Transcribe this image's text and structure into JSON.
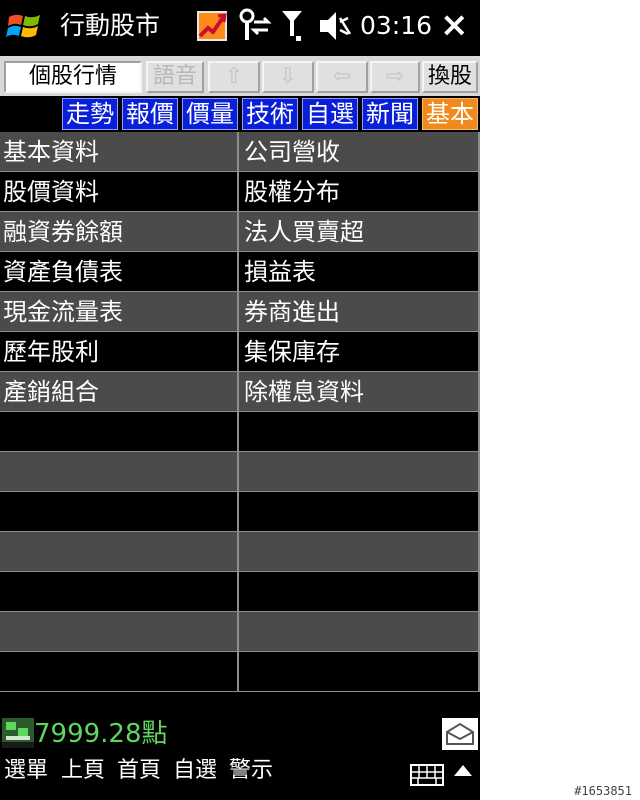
{
  "statusbar": {
    "app_title": "行動股市",
    "time": "03:16",
    "close_label": "×"
  },
  "toolbar": {
    "buttons": [
      {
        "label": "個股行情",
        "state": "pressed"
      },
      {
        "label": "語音",
        "state": "disabled"
      },
      {
        "label": "⇧",
        "state": "disabled"
      },
      {
        "label": "⇩",
        "state": "disabled"
      },
      {
        "label": "⇦",
        "state": "disabled"
      },
      {
        "label": "⇨",
        "state": "disabled"
      },
      {
        "label": "換股",
        "state": "enabled"
      }
    ]
  },
  "tabs": [
    {
      "label": "走勢"
    },
    {
      "label": "報價"
    },
    {
      "label": "價量"
    },
    {
      "label": "技術"
    },
    {
      "label": "自選"
    },
    {
      "label": "新聞"
    },
    {
      "label": "基本",
      "active": true
    }
  ],
  "grid": {
    "rows": [
      {
        "left": "基本資料",
        "right": "公司營收"
      },
      {
        "left": "股價資料",
        "right": "股權分布"
      },
      {
        "left": "融資券餘額",
        "right": "法人買賣超"
      },
      {
        "left": "資產負債表",
        "right": "損益表"
      },
      {
        "left": "現金流量表",
        "right": "券商進出"
      },
      {
        "left": "歷年股利",
        "right": "集保庫存"
      },
      {
        "left": "產銷組合",
        "right": "除權息資料"
      },
      {
        "left": "",
        "right": ""
      },
      {
        "left": "",
        "right": ""
      },
      {
        "left": "",
        "right": ""
      },
      {
        "left": "",
        "right": ""
      },
      {
        "left": "",
        "right": ""
      },
      {
        "left": "",
        "right": ""
      },
      {
        "left": "",
        "right": ""
      }
    ]
  },
  "indexbar": {
    "value": "7999.28點",
    "value_color": "#5fd65f"
  },
  "softkeys": {
    "items": [
      "選單",
      "上頁",
      "首頁",
      "自選",
      "警示"
    ]
  },
  "watermark": "#1653851",
  "colors": {
    "tab_blue": "#0a1fd8",
    "tab_active": "#f08a1c",
    "row_gray": "#4b4b4b"
  }
}
